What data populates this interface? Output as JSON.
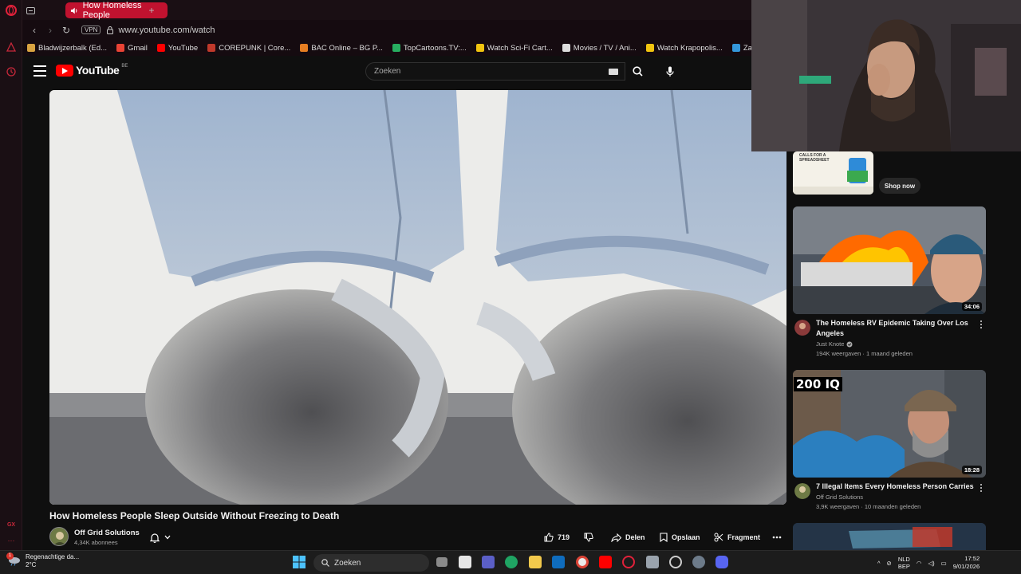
{
  "browser": {
    "active_tab_title": "How Homeless People",
    "url": "www.youtube.com/watch",
    "vpn_label": "VPN",
    "bookmarks": [
      {
        "label": "Bladwijzerbalk (Ed...",
        "color": "#d9a441"
      },
      {
        "label": "Gmail",
        "color": "#ea4335"
      },
      {
        "label": "YouTube",
        "color": "#ff0000"
      },
      {
        "label": "COREPUNK | Core...",
        "color": "#c0392b"
      },
      {
        "label": "BAC Online – BG P...",
        "color": "#e67e22"
      },
      {
        "label": "TopCartoons.TV:...",
        "color": "#27ae60"
      },
      {
        "label": "Watch Sci-Fi Cart...",
        "color": "#f1c40f"
      },
      {
        "label": "Movies / TV / Ani...",
        "color": "#dddddd"
      },
      {
        "label": "Watch Krapopolis...",
        "color": "#f1c40f"
      },
      {
        "label": "Zamnesia | Het Be",
        "color": "#3498db"
      }
    ]
  },
  "youtube": {
    "logo_text": "YouTube",
    "region": "BE",
    "search_placeholder": "Zoeken"
  },
  "video": {
    "title": "How Homeless People Sleep Outside Without Freezing to Death",
    "channel": "Off Grid Solutions",
    "subscribers": "4,34K abonnees",
    "likes": "719",
    "share_label": "Delen",
    "save_label": "Opslaan",
    "clip_label": "Fragment"
  },
  "sidebar": {
    "ad": {
      "thumb_text": "CALLS FOR A SPREADSHEET",
      "cta": "Shop now"
    },
    "recommendations": [
      {
        "title": "The Homeless RV Epidemic Taking Over Los Angeles",
        "channel": "Just Knote",
        "verified": true,
        "meta": "194K weergaven · 1 maand geleden",
        "duration": "34:06"
      },
      {
        "title": "7 Illegal Items Every Homeless Person Carries",
        "channel": "Off Grid Solutions",
        "verified": false,
        "meta": "3,9K weergaven · 10 maanden geleden",
        "duration": "18:28",
        "thumb_badge": "200 IQ"
      }
    ]
  },
  "taskbar": {
    "weather_desc": "Regenachtige da...",
    "weather_temp": "2°C",
    "weather_badge": "1",
    "search_label": "Zoeken",
    "lang_top": "NLD",
    "lang_bottom": "BEP",
    "time": "17:52",
    "date": "9/01/2026"
  },
  "colors": {
    "opera_red": "#c1122f",
    "youtube_red": "#ff0000",
    "background": "#0f0f0f"
  }
}
